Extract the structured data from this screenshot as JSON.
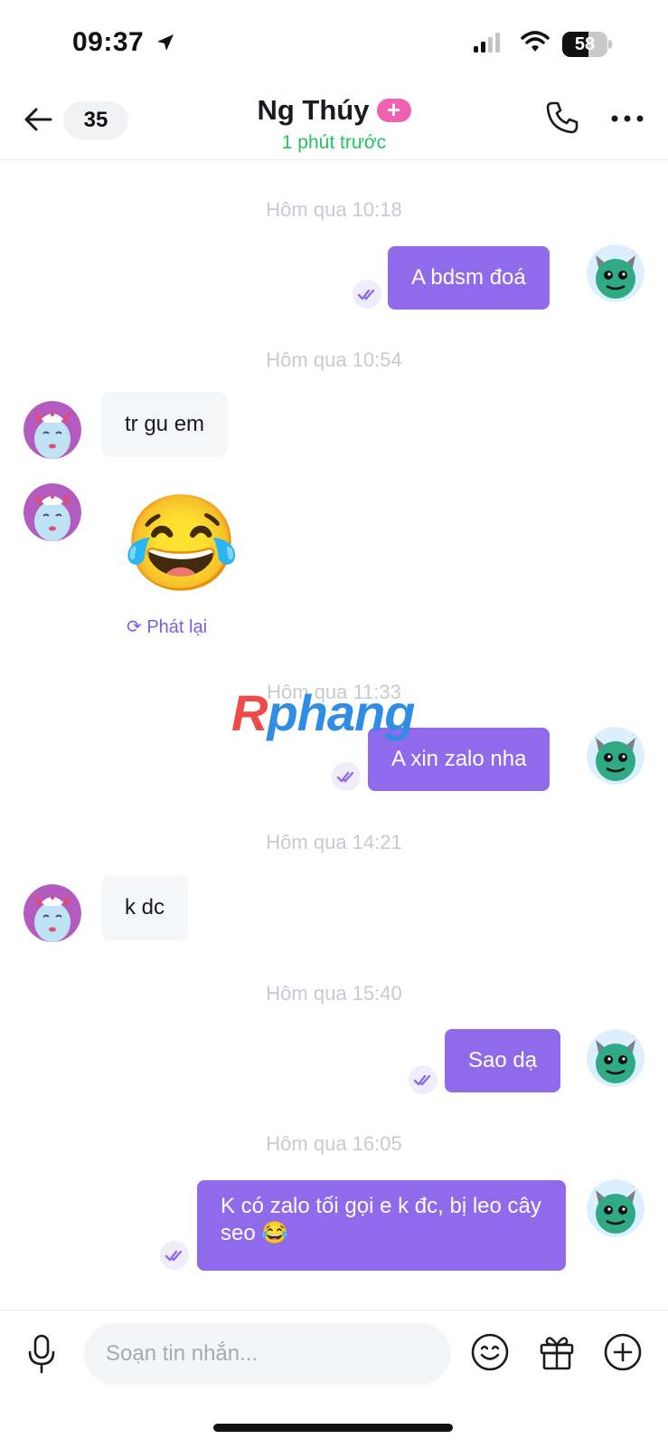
{
  "status_bar": {
    "time": "09:37",
    "battery_percent": "58",
    "icons": [
      "location-arrow-icon",
      "cellular-signal-icon",
      "wifi-icon",
      "battery-icon"
    ]
  },
  "header": {
    "unread_count": "35",
    "contact_name": "Ng Thúy",
    "badge": "+",
    "presence": "1 phút trước",
    "icons": [
      "back-arrow-icon",
      "phone-icon",
      "more-icon"
    ]
  },
  "messages": [
    {
      "type": "timestamp",
      "text": "Hôm qua 10:18"
    },
    {
      "type": "outgoing",
      "text": "A bdsm đoá",
      "status": "seen"
    },
    {
      "type": "timestamp",
      "text": "Hôm qua 10:54"
    },
    {
      "type": "incoming",
      "text": "tr gu em"
    },
    {
      "type": "incoming-sticker",
      "emoji": "😂",
      "action": "Phát lại"
    },
    {
      "type": "timestamp",
      "text": "Hôm qua 11:33"
    },
    {
      "type": "outgoing",
      "text": "A xin zalo nha",
      "status": "seen"
    },
    {
      "type": "timestamp",
      "text": "Hôm qua 14:21"
    },
    {
      "type": "incoming",
      "text": "k dc"
    },
    {
      "type": "timestamp",
      "text": "Hôm qua 15:40"
    },
    {
      "type": "outgoing",
      "text": "Sao dạ",
      "status": "seen"
    },
    {
      "type": "timestamp",
      "text": "Hôm qua 16:05"
    },
    {
      "type": "outgoing",
      "text": "K có zalo tối gọi e k đc, bị leo cây seo 😂",
      "status": "seen"
    }
  ],
  "watermark": {
    "first": "R",
    "rest": "phang"
  },
  "composer": {
    "placeholder": "Soạn tin nhắn...",
    "icons": [
      "microphone-icon",
      "emoji-icon",
      "gift-icon",
      "add-icon"
    ]
  },
  "colors": {
    "accent": "#8f6bec",
    "incoming_bubble": "#f5f6f8",
    "presence_green": "#22c55e",
    "badge_pink": "#f061b2",
    "timestamp_gray": "#c8cad0"
  }
}
